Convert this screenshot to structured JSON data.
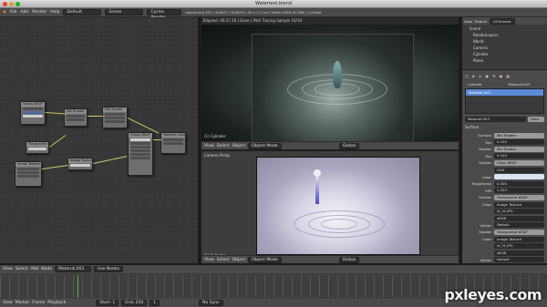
{
  "window": {
    "title": "Watertest.blend"
  },
  "info_header": {
    "menus": [
      "File",
      "Add",
      "Render",
      "Help"
    ],
    "screen": "Default",
    "scene": "Scene",
    "engine": "Cycles Render",
    "stats": "blender.org 262 | Ve:8017 | Fa:8159 | Ob:1-5 | La:0 | Mem:5.65M (0.25M) | Cylinder"
  },
  "node_editor": {
    "nodes": [
      "Mix Shader",
      "Mix Shader",
      "Glossy BSDF",
      "Material Output",
      "Transparent BSDF",
      "Glossy BSDF",
      "Image Texture",
      "Image Texture"
    ],
    "header": [
      "View",
      "Select",
      "Add",
      "Node"
    ],
    "material": "Material.003",
    "use_nodes": "Use Nodes"
  },
  "render_view": {
    "status": "Elapsed: 00:27.10 | Done | Path Tracing Sample 10/10",
    "label": "(1) Cylinder",
    "header": [
      "View",
      "Select",
      "Object",
      "Object Mode"
    ],
    "shading": "Global"
  },
  "camera_view": {
    "label_top": "Camera Persp",
    "label_bottom": "(1) Cylinder",
    "header": [
      "View",
      "Select",
      "Object",
      "Object Mode"
    ],
    "shading": "Global"
  },
  "outliner": {
    "header": [
      "View",
      "Search",
      "All Scenes"
    ],
    "items": [
      "Scene",
      "RenderLayers",
      "World",
      "Camera",
      "Cylinder",
      "Plane"
    ]
  },
  "properties": {
    "object": "Cylinder",
    "material": "Material.003",
    "slot": "Material.003",
    "data_label": "Data",
    "section": "Surface",
    "rows": [
      {
        "label": "Surface:",
        "value": "Mix Shader"
      },
      {
        "label": "Fac:",
        "value": "0.100"
      },
      {
        "label": "Shader:",
        "value": "Mix Shader"
      },
      {
        "label": "Fac:",
        "value": "0.100"
      },
      {
        "label": "Shader:",
        "value": "Glass BSDF"
      },
      {
        "label": "",
        "value": "GGX"
      },
      {
        "label": "Color:",
        "value": ""
      },
      {
        "label": "Roughness:",
        "value": "0.500"
      },
      {
        "label": "IOR:",
        "value": "1.333"
      },
      {
        "label": "Shader:",
        "value": "Transparent BSDF"
      },
      {
        "label": "Color:",
        "value": "Image Texture"
      },
      {
        "label": "",
        "value": "sf_31.JPG"
      },
      {
        "label": "",
        "value": "sRGB"
      },
      {
        "label": "Vector:",
        "value": "Default"
      },
      {
        "label": "Shader:",
        "value": "Transparent BSDF"
      },
      {
        "label": "Color:",
        "value": "Image Texture"
      },
      {
        "label": "",
        "value": "sf_31.JPG"
      },
      {
        "label": "",
        "value": "sRGB"
      },
      {
        "label": "Vector:",
        "value": "Default"
      }
    ]
  },
  "timeline": {
    "header": [
      "View",
      "Marker",
      "Frame",
      "Playback"
    ],
    "start": "Start: 1",
    "end": "End: 250",
    "current": "1",
    "sync": "No Sync"
  },
  "watermark": "pxleyes.com",
  "colors": {
    "accent": "#5a8ad8",
    "wire": "#c9c96a"
  }
}
